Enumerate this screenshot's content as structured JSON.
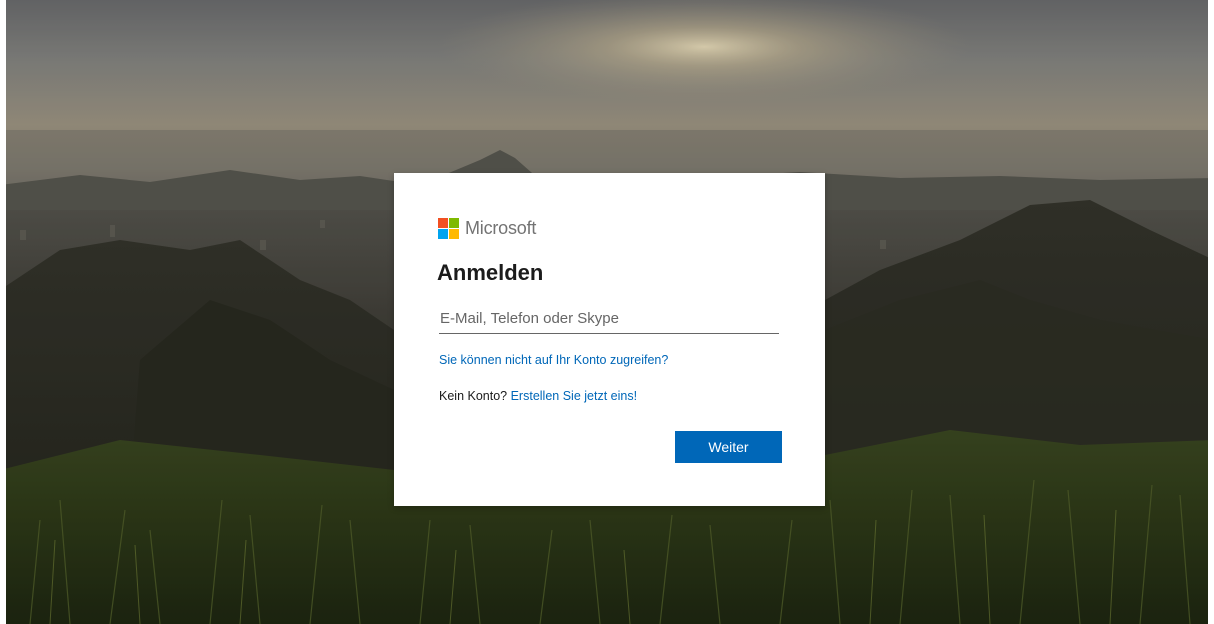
{
  "background": {
    "description_icon": "landscape-photo"
  },
  "card": {
    "brand": {
      "name": "Microsoft",
      "logo_colors": [
        "#f25022",
        "#7fba00",
        "#00a4ef",
        "#ffb900"
      ]
    },
    "title": "Anmelden",
    "email": {
      "placeholder": "E-Mail, Telefon oder Skype",
      "value": ""
    },
    "cant_access_link": "Sie können nicht auf Ihr Konto zugreifen?",
    "no_account_prefix": "Kein Konto?",
    "create_account_link": "Erstellen Sie jetzt eins!",
    "next_button": "Weiter"
  },
  "colors": {
    "accent": "#0067b8",
    "text": "#1b1b1b",
    "muted": "#737373"
  }
}
